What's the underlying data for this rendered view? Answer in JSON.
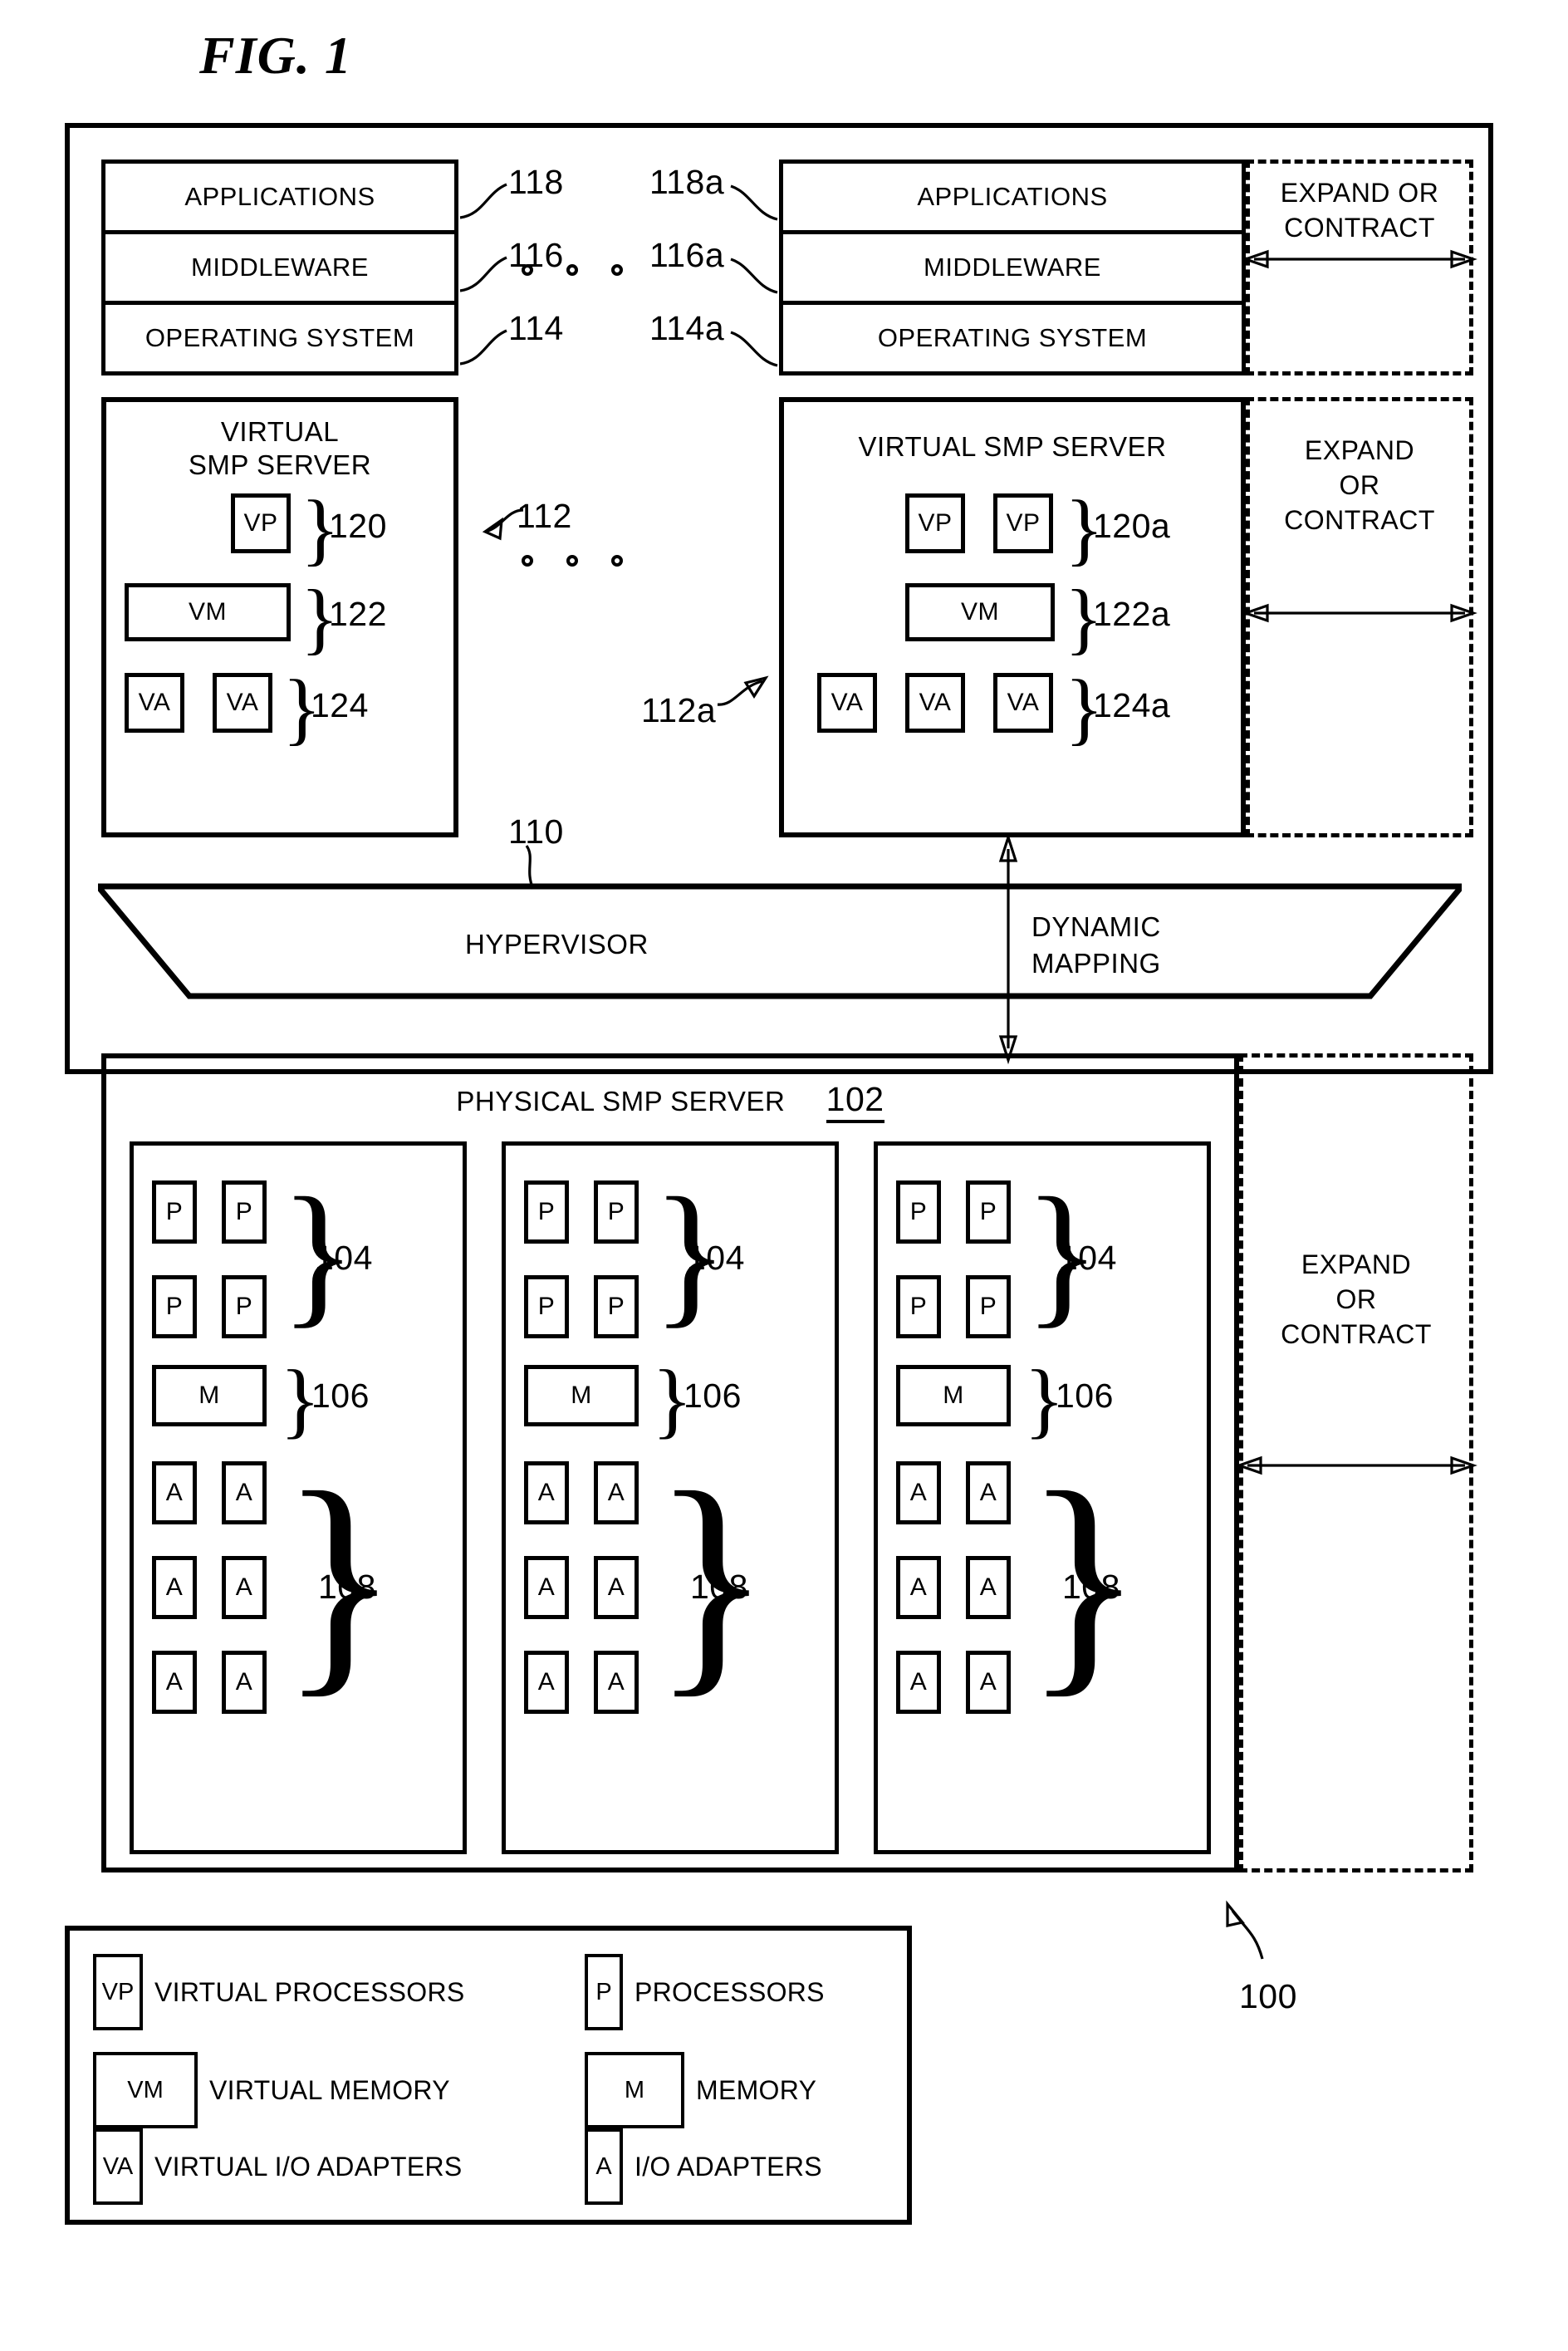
{
  "figure": {
    "title": "FIG. 1",
    "system_ref": "100"
  },
  "software_stacks": {
    "left": {
      "rows": [
        {
          "label": "APPLICATIONS",
          "ref": "118"
        },
        {
          "label": "MIDDLEWARE",
          "ref": "116"
        },
        {
          "label": "OPERATING SYSTEM",
          "ref": "114"
        }
      ]
    },
    "right": {
      "rows": [
        {
          "label": "APPLICATIONS",
          "ref": "118a"
        },
        {
          "label": "MIDDLEWARE",
          "ref": "116a"
        },
        {
          "label": "OPERATING SYSTEM",
          "ref": "114a"
        }
      ]
    }
  },
  "virtual_servers": {
    "left": {
      "title_line1": "VIRTUAL",
      "title_line2": "SMP SERVER",
      "ref": "112",
      "groups": [
        {
          "kind": "VP",
          "count": 1,
          "ref": "120"
        },
        {
          "kind": "VM",
          "count": 1,
          "ref": "122"
        },
        {
          "kind": "VA",
          "count": 2,
          "ref": "124"
        }
      ]
    },
    "right": {
      "title_line1": "VIRTUAL SMP SERVER",
      "title_line2": "",
      "ref": "112a",
      "groups": [
        {
          "kind": "VP",
          "count": 2,
          "ref": "120a"
        },
        {
          "kind": "VM",
          "count": 1,
          "ref": "122a"
        },
        {
          "kind": "VA",
          "count": 3,
          "ref": "124a"
        }
      ]
    }
  },
  "expand_panels": {
    "software": {
      "line1": "EXPAND OR",
      "line2": "CONTRACT"
    },
    "virtual": {
      "line1": "EXPAND",
      "line2": "OR",
      "line3": "CONTRACT"
    },
    "physical": {
      "line1": "EXPAND",
      "line2": "OR",
      "line3": "CONTRACT"
    }
  },
  "hypervisor": {
    "label": "HYPERVISOR",
    "ref": "110",
    "mapping_line1": "DYNAMIC",
    "mapping_line2": "MAPPING"
  },
  "physical_server": {
    "title": "PHYSICAL SMP SERVER",
    "ref": "102",
    "columns": [
      {
        "processors": {
          "kind": "P",
          "count": 4,
          "ref": "104"
        },
        "memory": {
          "kind": "M",
          "count": 1,
          "ref": "106"
        },
        "adapters": {
          "kind": "A",
          "count": 6,
          "ref": "108"
        }
      },
      {
        "processors": {
          "kind": "P",
          "count": 4,
          "ref": "104"
        },
        "memory": {
          "kind": "M",
          "count": 1,
          "ref": "106"
        },
        "adapters": {
          "kind": "A",
          "count": 6,
          "ref": "108"
        }
      },
      {
        "processors": {
          "kind": "P",
          "count": 4,
          "ref": "104"
        },
        "memory": {
          "kind": "M",
          "count": 1,
          "ref": "106"
        },
        "adapters": {
          "kind": "A",
          "count": 6,
          "ref": "108"
        }
      }
    ]
  },
  "legend": {
    "entries": [
      {
        "symbol": "VP",
        "label": "VIRTUAL PROCESSORS"
      },
      {
        "symbol": "P",
        "label": "PROCESSORS"
      },
      {
        "symbol": "VM",
        "label": "VIRTUAL MEMORY"
      },
      {
        "symbol": "M",
        "label": "MEMORY"
      },
      {
        "symbol": "VA",
        "label": "VIRTUAL I/O ADAPTERS"
      },
      {
        "symbol": "A",
        "label": "I/O ADAPTERS"
      }
    ]
  }
}
